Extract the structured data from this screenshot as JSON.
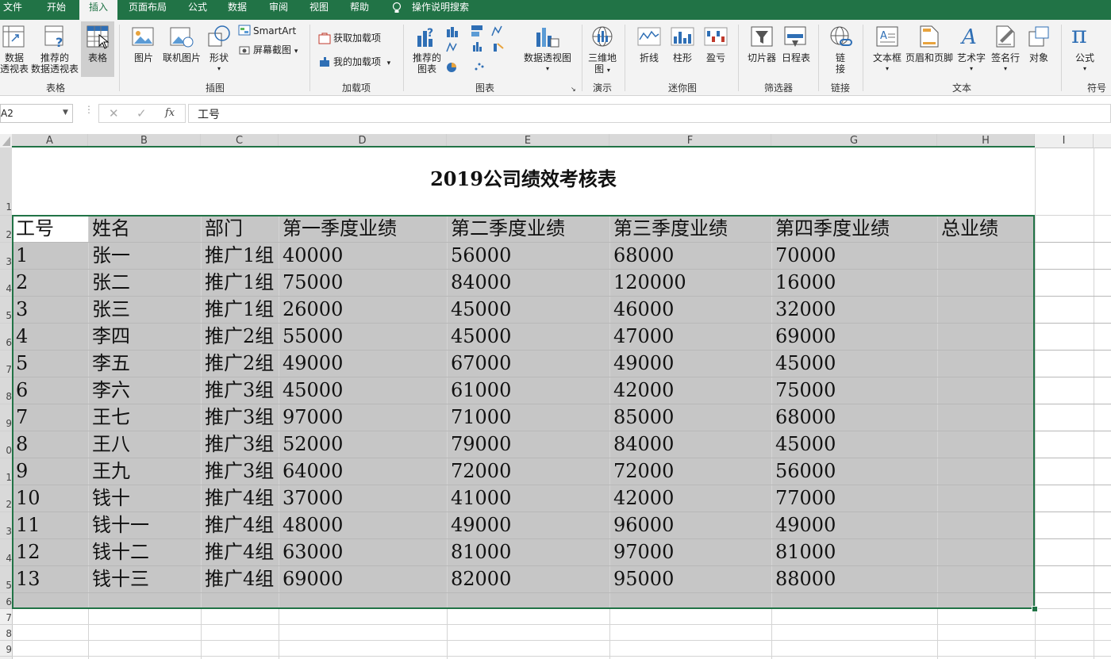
{
  "menu": {
    "tabs": [
      {
        "label": "文件"
      },
      {
        "label": "开始"
      },
      {
        "label": "插入"
      },
      {
        "label": "页面布局"
      },
      {
        "label": "公式"
      },
      {
        "label": "数据"
      },
      {
        "label": "审阅"
      },
      {
        "label": "视图"
      },
      {
        "label": "帮助"
      }
    ],
    "active_tab": "插入",
    "tell_me": "操作说明搜索"
  },
  "ribbon": {
    "groups": {
      "tables": "表格",
      "illustrations": "插图",
      "addins": "加载项",
      "charts": "图表",
      "tours": "演示",
      "sparklines": "迷你图",
      "filters": "筛选器",
      "links": "链接",
      "text": "文本",
      "symbols": "符号"
    },
    "items": {
      "pivot_line1": "数据",
      "pivot_line2": "透视表",
      "rec_pivot_line1": "推荐的",
      "rec_pivot_line2": "数据透视表",
      "table": "表格",
      "pictures": "图片",
      "online_pictures": "联机图片",
      "shapes": "形状",
      "smartart": "SmartArt",
      "screenshot": "屏幕截图",
      "get_addins": "获取加载项",
      "my_addins": "我的加载项",
      "rec_charts_line1": "推荐的",
      "rec_charts_line2": "图表",
      "pivot_chart": "数据透视图",
      "map3d_line1": "三维地",
      "map3d_line2": "图",
      "spark_line": "折线",
      "spark_column": "柱形",
      "spark_winloss": "盈亏",
      "slicer": "切片器",
      "timeline": "日程表",
      "link_line1": "链",
      "link_line2": "接",
      "textbox": "文本框",
      "header_footer": "页眉和页脚",
      "wordart": "艺术字",
      "signature": "签名行",
      "object": "对象",
      "equation": "公式",
      "equation_icon": "π"
    }
  },
  "formula_bar": {
    "name_box": "A2",
    "fx": "fx",
    "value": "工号"
  },
  "sheet": {
    "columns": [
      "A",
      "B",
      "C",
      "D",
      "E",
      "F",
      "G",
      "H",
      "I"
    ],
    "row_numbers": [
      "1",
      "2",
      "3",
      "4",
      "5",
      "6",
      "7",
      "8",
      "9",
      "0",
      "1",
      "2",
      "3",
      "4",
      "5",
      "6",
      "7",
      "8",
      "9"
    ],
    "title": "2019公司绩效考核表",
    "headers": [
      "工号",
      "姓名",
      "部门",
      "第一季度业绩",
      "第二季度业绩",
      "第三季度业绩",
      "第四季度业绩",
      "总业绩"
    ],
    "rows": [
      [
        "1",
        "张一",
        "推广1组",
        "40000",
        "56000",
        "68000",
        "70000",
        ""
      ],
      [
        "2",
        "张二",
        "推广1组",
        "75000",
        "84000",
        "120000",
        "16000",
        ""
      ],
      [
        "3",
        "张三",
        "推广1组",
        "26000",
        "45000",
        "46000",
        "32000",
        ""
      ],
      [
        "4",
        "李四",
        "推广2组",
        "55000",
        "45000",
        "47000",
        "69000",
        ""
      ],
      [
        "5",
        "李五",
        "推广2组",
        "49000",
        "67000",
        "49000",
        "45000",
        ""
      ],
      [
        "6",
        "李六",
        "推广3组",
        "45000",
        "61000",
        "42000",
        "75000",
        ""
      ],
      [
        "7",
        "王七",
        "推广3组",
        "97000",
        "71000",
        "85000",
        "68000",
        ""
      ],
      [
        "8",
        "王八",
        "推广3组",
        "52000",
        "79000",
        "84000",
        "45000",
        ""
      ],
      [
        "9",
        "王九",
        "推广3组",
        "64000",
        "72000",
        "72000",
        "56000",
        ""
      ],
      [
        "10",
        "钱十",
        "推广4组",
        "37000",
        "41000",
        "42000",
        "77000",
        ""
      ],
      [
        "11",
        "钱十一",
        "推广4组",
        "48000",
        "49000",
        "96000",
        "49000",
        ""
      ],
      [
        "12",
        "钱十二",
        "推广4组",
        "63000",
        "81000",
        "97000",
        "81000",
        ""
      ],
      [
        "13",
        "钱十三",
        "推广4组",
        "69000",
        "82000",
        "95000",
        "88000",
        ""
      ]
    ]
  },
  "colors": {
    "accent": "#217346",
    "selection_fill": "#c6c6c6",
    "grid_line": "#d4d4d4"
  }
}
